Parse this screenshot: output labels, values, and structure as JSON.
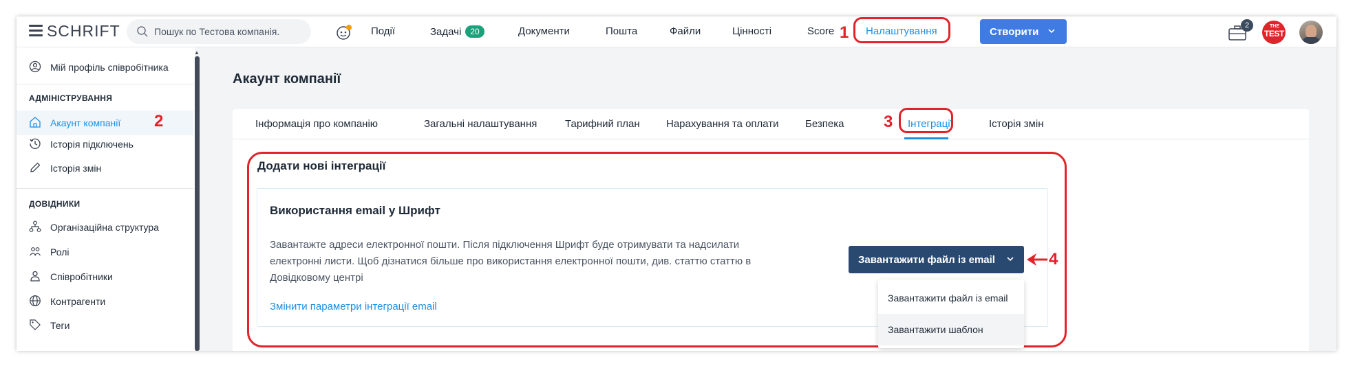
{
  "app": {
    "logo": "SCHRIFT"
  },
  "search": {
    "placeholder": "Пошук по Тестова компанія."
  },
  "nav": {
    "items": [
      {
        "label": "Події"
      },
      {
        "label": "Задачі",
        "badge": "20"
      },
      {
        "label": "Документи"
      },
      {
        "label": "Пошта"
      },
      {
        "label": "Файли"
      },
      {
        "label": "Цінності"
      },
      {
        "label": "Score"
      },
      {
        "label": "Налаштування",
        "active": true
      }
    ],
    "create_label": "Створити",
    "case_badge": "2",
    "test_logo_top": "THE",
    "test_logo_main": "TEST"
  },
  "sidebar": {
    "profile": "Мій профіль співробітника",
    "admin_section": "АДМІНІСТРУВАННЯ",
    "admin_items": [
      {
        "label": "Акаунт компанії",
        "active": true
      },
      {
        "label": "Історія підключень"
      },
      {
        "label": "Історія змін"
      }
    ],
    "dict_section": "ДОВІДНИКИ",
    "dict_items": [
      {
        "label": "Організаційна структура"
      },
      {
        "label": "Ролі"
      },
      {
        "label": "Співробітники"
      },
      {
        "label": "Контрагенти"
      },
      {
        "label": "Теги"
      }
    ]
  },
  "main": {
    "title": "Акаунт компанії",
    "tabs": [
      {
        "label": "Інформація про компанію"
      },
      {
        "label": "Загальні налаштування"
      },
      {
        "label": "Тарифний план"
      },
      {
        "label": "Нарахування та оплати"
      },
      {
        "label": "Безпека"
      },
      {
        "label": "Інтеграції",
        "active": true
      },
      {
        "label": "Історія змін"
      }
    ],
    "section_title": "Додати нові інтеграції",
    "integration": {
      "title": "Використання email у Шрифт",
      "description": "Завантажте адреси електронної пошти. Після підключення Шрифт буде отримувати та надсилати електронні листи. Щоб дізнатися більше про використання електронної пошти, див. статтю статтю в Довідковому центрі",
      "link": "Змінити параметри інтеграції email",
      "button_label": "Завантажити файл із email",
      "dropdown_options": [
        "Завантажити файл із email",
        "Завантажити шаблон"
      ]
    }
  },
  "annotations": {
    "color": "#e1232a",
    "labels": [
      "1",
      "2",
      "3",
      "4"
    ]
  },
  "colors": {
    "accent": "#1a8fe3",
    "primary_button": "#3f7be3",
    "dark_button": "#2a4970",
    "badge_green": "#1aa37a"
  }
}
